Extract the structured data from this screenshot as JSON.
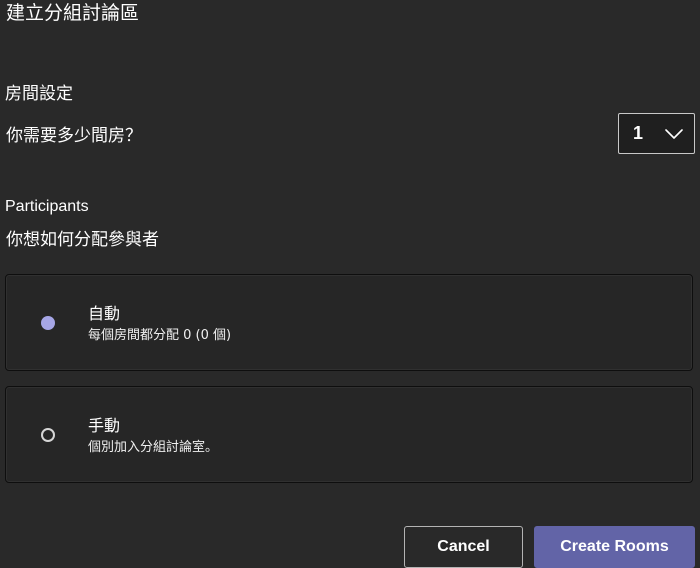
{
  "dialog": {
    "title": "建立分組討論區"
  },
  "room_settings": {
    "heading": "房間設定",
    "question": "你需要多少間房？",
    "room_count_select": {
      "value": "1",
      "icon": "chevron-down-icon"
    }
  },
  "participants": {
    "label": "Participants",
    "question": "你想如何分配參與者",
    "options": [
      {
        "title": "自動",
        "description": "每個房間都分配 0 (0 個)",
        "selected": true
      },
      {
        "title": "手動",
        "description": "個別加入分組討論室。",
        "selected": false
      }
    ]
  },
  "actions": {
    "cancel_label": "Cancel",
    "create_label": "Create Rooms"
  },
  "colors": {
    "background": "#292929",
    "accent": "#6264a7",
    "selected_radio": "#a6a6e6"
  }
}
